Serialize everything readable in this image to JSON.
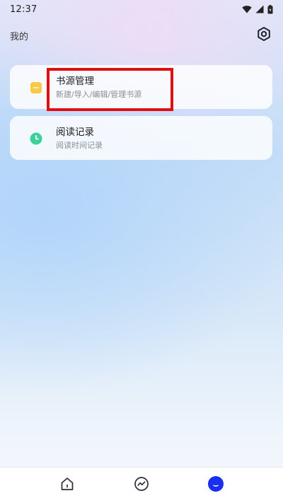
{
  "status_bar": {
    "time": "12:37",
    "icons": [
      "wifi-icon",
      "signal-icon",
      "battery-icon"
    ]
  },
  "header": {
    "title": "我的",
    "settings_icon": "gear-icon"
  },
  "menu": {
    "items": [
      {
        "title": "书源管理",
        "subtitle": "新建/导入/编辑/管理书源",
        "icon": "book-source-icon",
        "icon_color": "#f7c948"
      },
      {
        "title": "阅读记录",
        "subtitle": "阅读时间记录",
        "icon": "clock-icon",
        "icon_color": "#3ecf9a"
      }
    ]
  },
  "bottom_nav": {
    "items": [
      {
        "name": "home",
        "icon": "home-icon",
        "active": false
      },
      {
        "name": "explore",
        "icon": "trend-icon",
        "active": false
      },
      {
        "name": "mine",
        "icon": "profile-icon",
        "active": true
      }
    ],
    "active_color": "#1a2ef0"
  },
  "colors": {
    "highlight": "#e01010"
  }
}
